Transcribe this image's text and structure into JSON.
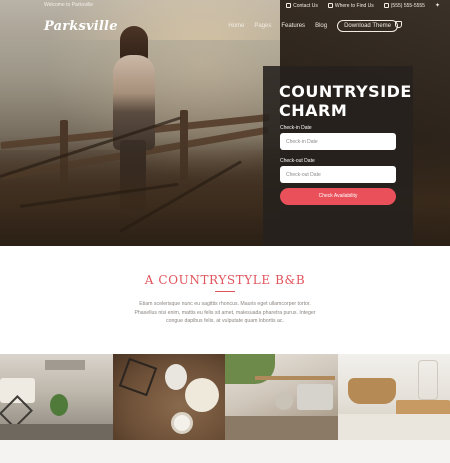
{
  "topbar": {
    "welcome": "Welcome to Parksville",
    "links": [
      "Contact Us",
      "Where to Find Us",
      "(555) 555-5555"
    ]
  },
  "header": {
    "logo": "Parksville",
    "nav": [
      "Home",
      "Pages",
      "Features",
      "Blog"
    ],
    "cta": "Download Theme"
  },
  "booking": {
    "title": "COUNTRYSIDE CHARM",
    "checkin_label": "Check-in Date",
    "checkin_placeholder": "Check-in Date",
    "checkout_label": "Check-out Date",
    "checkout_placeholder": "Check-out Date",
    "button": "Check Availability"
  },
  "intro": {
    "title": "A COUNTRYSTYLE B&B",
    "body": "Etiam scelerisque nunc eu sagittis rhoncus. Mauris eget ullamcorper tortor. Phasellus nisi enim, mattis eu felis sit amet, malesuada pharetra purus. Integer congue dapibus felis, at vulputate quam lobortis ac."
  },
  "colors": {
    "accent": "#e9505a",
    "card_bg": "#26211e"
  },
  "icons": [
    "phone-icon",
    "map-pin-icon",
    "phone-icon",
    "twitter-icon",
    "shopping-bag-icon"
  ]
}
